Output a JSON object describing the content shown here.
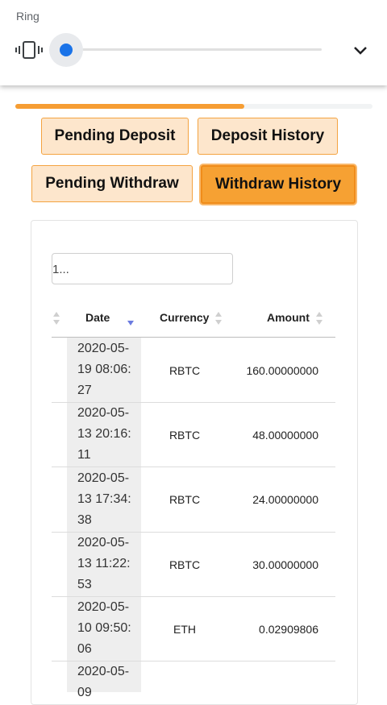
{
  "volume_panel": {
    "label": "Ring",
    "icons": {
      "mode": "vibrate-icon",
      "expand": "chevron-down-icon"
    },
    "level": 0.0
  },
  "progress": {
    "fraction": 0.64,
    "color": "#f69d33"
  },
  "tabs": [
    {
      "label": "Pending Deposit",
      "active": false
    },
    {
      "label": "Deposit History",
      "active": false
    },
    {
      "label": "Pending Withdraw",
      "active": false
    },
    {
      "label": "Withdraw History",
      "active": true
    }
  ],
  "search": {
    "value": "1..."
  },
  "table": {
    "columns": [
      {
        "label": "",
        "sort": "none"
      },
      {
        "label": "Date",
        "sort": "desc"
      },
      {
        "label": "Currency",
        "sort": "none"
      },
      {
        "label": "Amount",
        "sort": "none"
      }
    ],
    "rows": [
      {
        "date": "2020-05-19 08:06:27",
        "currency": "RBTC",
        "amount": "160.00000000"
      },
      {
        "date": "2020-05-13 20:16:11",
        "currency": "RBTC",
        "amount": "48.00000000"
      },
      {
        "date": "2020-05-13 17:34:38",
        "currency": "RBTC",
        "amount": "24.00000000"
      },
      {
        "date": "2020-05-13 11:22:53",
        "currency": "RBTC",
        "amount": "30.00000000"
      },
      {
        "date": "2020-05-10 09:50:06",
        "currency": "ETH",
        "amount": "0.02909806"
      },
      {
        "date": "2020-05-09",
        "currency": "",
        "amount": ""
      }
    ]
  },
  "colors": {
    "accent": "#f69d33",
    "tab_bg": "#fde6cc",
    "tab_border": "#f4a340",
    "slider": "#1a73e8"
  }
}
